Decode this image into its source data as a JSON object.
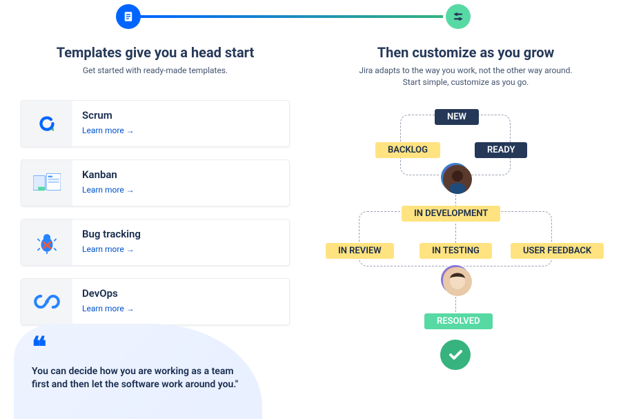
{
  "progress": {
    "left_icon": "document-icon",
    "right_icon": "customize-icon"
  },
  "left": {
    "heading": "Templates give you a head start",
    "subtitle": "Get started with ready-made templates.",
    "templates": [
      {
        "name": "Scrum",
        "link": "Learn more →",
        "icon": "scrum-icon"
      },
      {
        "name": "Kanban",
        "link": "Learn more →",
        "icon": "kanban-icon"
      },
      {
        "name": "Bug tracking",
        "link": "Learn more →",
        "icon": "bug-icon"
      },
      {
        "name": "DevOps",
        "link": "Learn more →",
        "icon": "devops-icon"
      }
    ]
  },
  "right": {
    "heading": "Then customize as you grow",
    "subtitle_line1": "Jira adapts to the way you work, not the other way around.",
    "subtitle_line2": "Start simple, customize as you go.",
    "statuses": {
      "new": "NEW",
      "backlog": "BACKLOG",
      "ready": "READY",
      "in_development": "IN DEVELOPMENT",
      "in_review": "IN REVIEW",
      "in_testing": "IN TESTING",
      "user_feedback": "USER FEEDBACK",
      "resolved": "RESOLVED"
    }
  },
  "quote": {
    "text": "You can decide how you are working as a team first and then let the software work around you.\""
  }
}
